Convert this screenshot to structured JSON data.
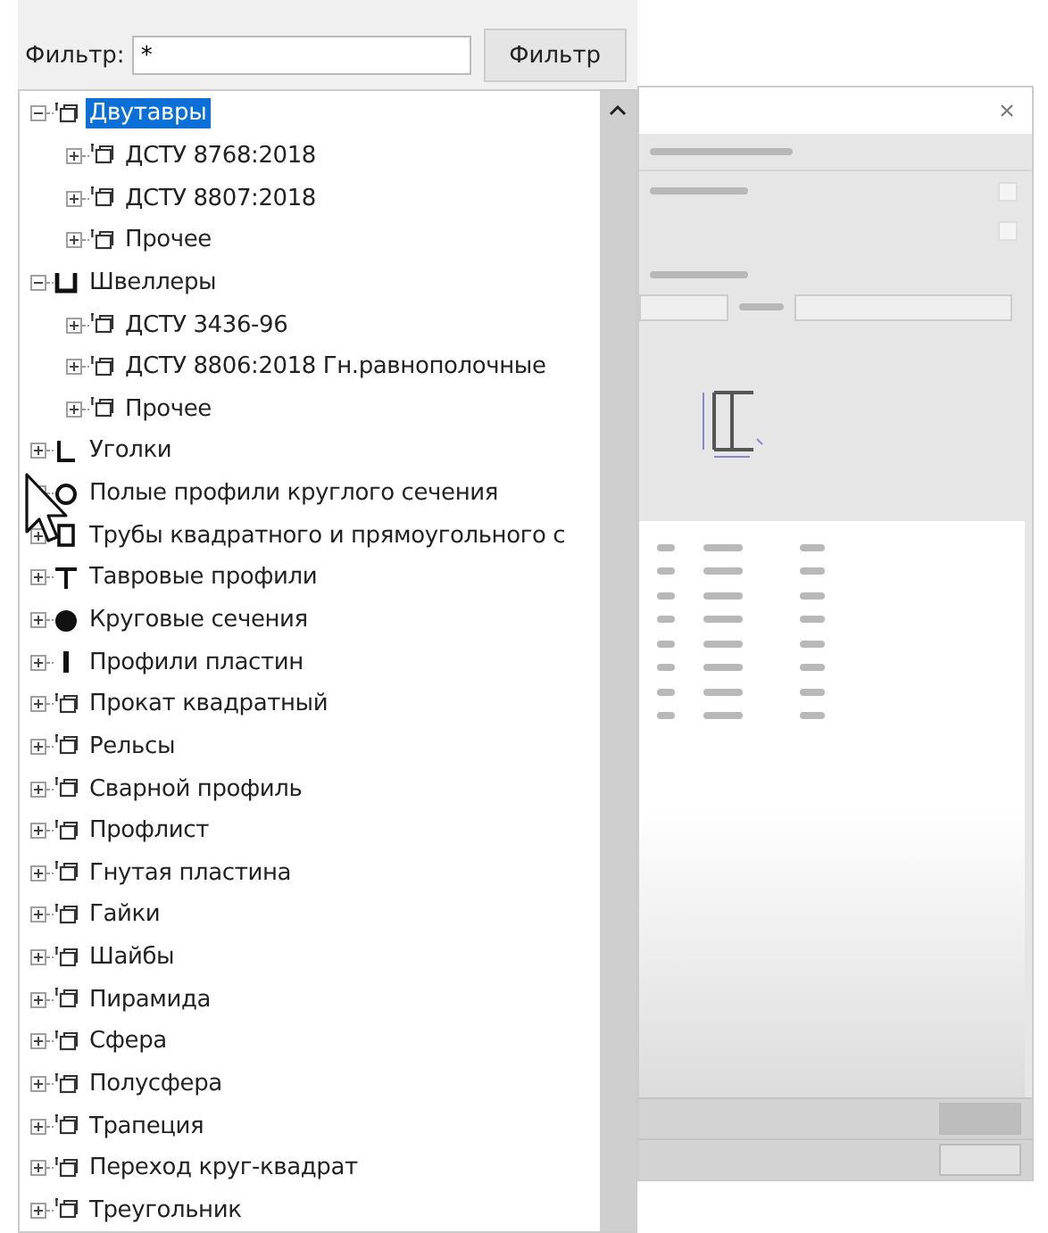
{
  "dialog": {
    "checkboxes": [
      {
        "checked": false
      },
      {
        "checked": false
      }
    ]
  },
  "filter": {
    "label": "Фильтр:",
    "value": "*",
    "button": "Фильтр"
  },
  "tree": [
    {
      "label": "Двутавры",
      "kind": "folder",
      "expanded": true,
      "selected": true,
      "children": [
        {
          "label": "ДСТУ 8768:2018",
          "kind": "folder",
          "expanded": false,
          "selected": false
        },
        {
          "label": "ДСТУ 8807:2018",
          "kind": "folder",
          "expanded": false,
          "selected": false
        },
        {
          "label": "Прочее",
          "kind": "folder",
          "expanded": false,
          "selected": false
        }
      ]
    },
    {
      "label": "Швеллеры",
      "kind": "channel",
      "expanded": true,
      "selected": false,
      "children": [
        {
          "label": "ДСТУ 3436-96",
          "kind": "folder",
          "expanded": false,
          "selected": false
        },
        {
          "label": "ДСТУ 8806:2018 Гн.равнополочные",
          "kind": "folder",
          "expanded": false,
          "selected": false
        },
        {
          "label": "Прочее",
          "kind": "folder",
          "expanded": false,
          "selected": false
        }
      ]
    },
    {
      "label": "Уголки",
      "kind": "angle",
      "expanded": false,
      "selected": false
    },
    {
      "label": "Полые профили круглого сечения",
      "kind": "pipe",
      "expanded": false,
      "selected": false
    },
    {
      "label": "Трубы квадратного и прямоугольного с",
      "kind": "tube",
      "expanded": false,
      "selected": false
    },
    {
      "label": "Тавровые профили",
      "kind": "tee",
      "expanded": false,
      "selected": false
    },
    {
      "label": "Круговые сечения",
      "kind": "round",
      "expanded": false,
      "selected": false
    },
    {
      "label": "Профили пластин",
      "kind": "plate",
      "expanded": false,
      "selected": false
    },
    {
      "label": "Прокат квадратный",
      "kind": "folder",
      "expanded": false,
      "selected": false
    },
    {
      "label": "Рельсы",
      "kind": "folder",
      "expanded": false,
      "selected": false
    },
    {
      "label": "Сварной профиль",
      "kind": "folder",
      "expanded": false,
      "selected": false
    },
    {
      "label": "Профлист",
      "kind": "folder",
      "expanded": false,
      "selected": false
    },
    {
      "label": "Гнутая пластина",
      "kind": "folder",
      "expanded": false,
      "selected": false
    },
    {
      "label": "Гайки",
      "kind": "folder",
      "expanded": false,
      "selected": false
    },
    {
      "label": "Шайбы",
      "kind": "folder",
      "expanded": false,
      "selected": false
    },
    {
      "label": "Пирамида",
      "kind": "folder",
      "expanded": false,
      "selected": false
    },
    {
      "label": "Сфера",
      "kind": "folder",
      "expanded": false,
      "selected": false
    },
    {
      "label": "Полусфера",
      "kind": "folder",
      "expanded": false,
      "selected": false
    },
    {
      "label": "Трапеция",
      "kind": "folder",
      "expanded": false,
      "selected": false
    },
    {
      "label": "Переход круг-квадрат",
      "kind": "folder",
      "expanded": false,
      "selected": false
    },
    {
      "label": "Треугольник",
      "kind": "folder",
      "expanded": false,
      "selected": false
    }
  ]
}
